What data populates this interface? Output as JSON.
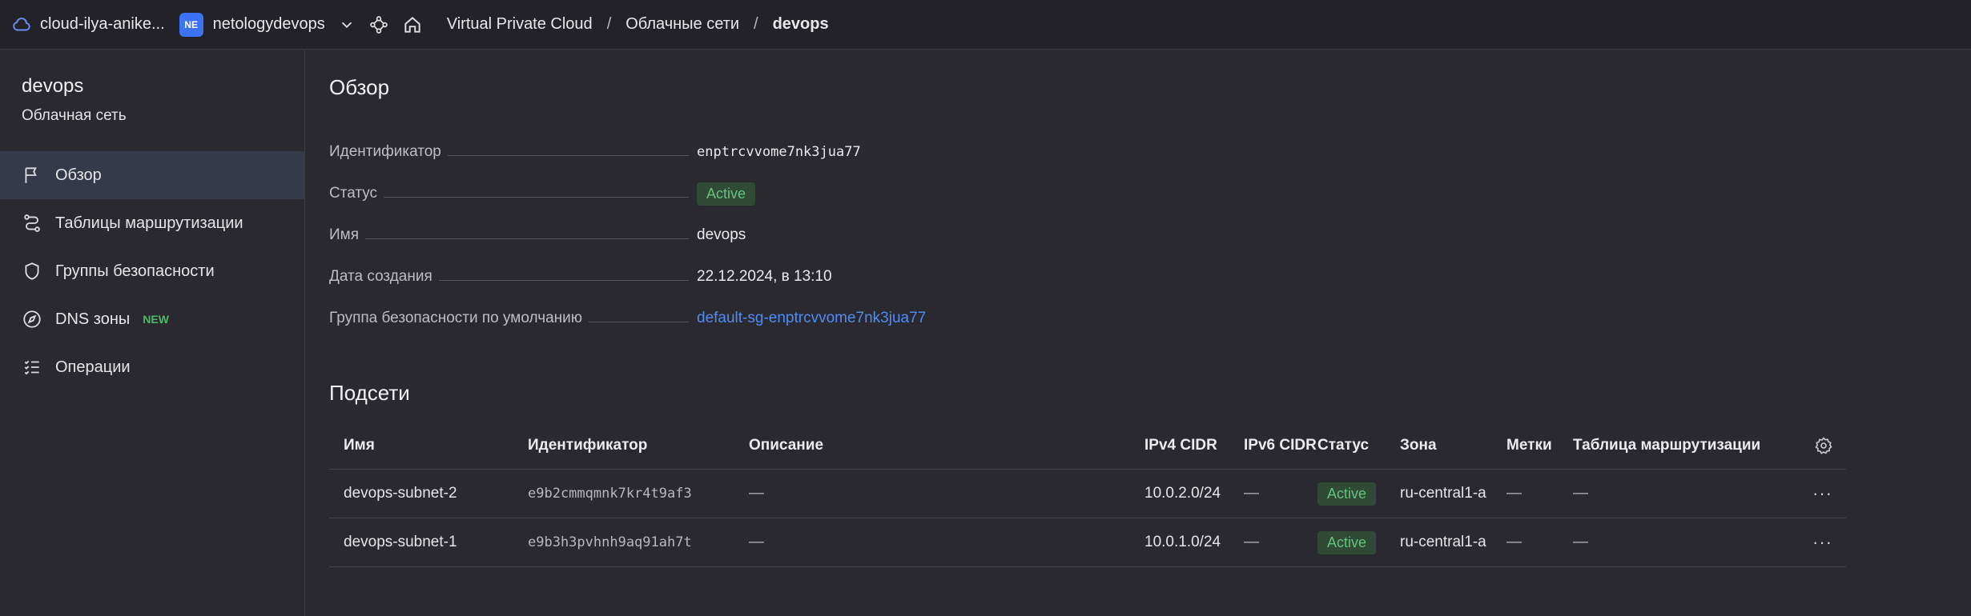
{
  "header": {
    "cloud_name": "cloud-ilya-anike...",
    "org_badge": "NE",
    "org_name": "netologydevops",
    "breadcrumbs": [
      "Virtual Private Cloud",
      "Облачные сети",
      "devops"
    ],
    "separator": "/"
  },
  "sidebar": {
    "title": "devops",
    "subtitle": "Облачная сеть",
    "items": [
      {
        "label": "Обзор",
        "icon": "flag-icon",
        "active": true
      },
      {
        "label": "Таблицы маршрутизации",
        "icon": "route-icon"
      },
      {
        "label": "Группы безопасности",
        "icon": "shield-icon"
      },
      {
        "label": "DNS зоны",
        "icon": "compass-icon",
        "badge": "NEW"
      },
      {
        "label": "Операции",
        "icon": "list-icon"
      }
    ]
  },
  "overview": {
    "title": "Обзор",
    "fields": [
      {
        "label": "Идентификатор",
        "value": "enptrcvvome7nk3jua77"
      },
      {
        "label": "Статус",
        "value": "Active"
      },
      {
        "label": "Имя",
        "value": "devops"
      },
      {
        "label": "Дата создания",
        "value": "22.12.2024, в 13:10"
      },
      {
        "label": "Группа безопасности по умолчанию",
        "value": "default-sg-enptrcvvome7nk3jua77"
      }
    ]
  },
  "subnets": {
    "title": "Подсети",
    "columns": [
      "Имя",
      "Идентификатор",
      "Описание",
      "IPv4 CIDR",
      "IPv6 CIDR",
      "Статус",
      "Зона",
      "Метки",
      "Таблица маршрутизации"
    ],
    "rows": [
      {
        "name": "devops-subnet-2",
        "id": "e9b2cmmqmnk7kr4t9af3",
        "description": "—",
        "ipv4": "10.0.2.0/24",
        "ipv6": "—",
        "status": "Active",
        "zone": "ru-central1-a",
        "labels": "—",
        "route_table": "—",
        "more": "···"
      },
      {
        "name": "devops-subnet-1",
        "id": "e9b3h3pvhnh9aq91ah7t",
        "description": "—",
        "ipv4": "10.0.1.0/24",
        "ipv6": "—",
        "status": "Active",
        "zone": "ru-central1-a",
        "labels": "—",
        "route_table": "—",
        "more": "···"
      }
    ]
  },
  "colors": {
    "accent": "#3d72f5",
    "link": "#4f8cf6",
    "status_active_bg": "#2f4a35",
    "status_active_text": "#66c27e",
    "new_badge": "#4cb86a"
  }
}
